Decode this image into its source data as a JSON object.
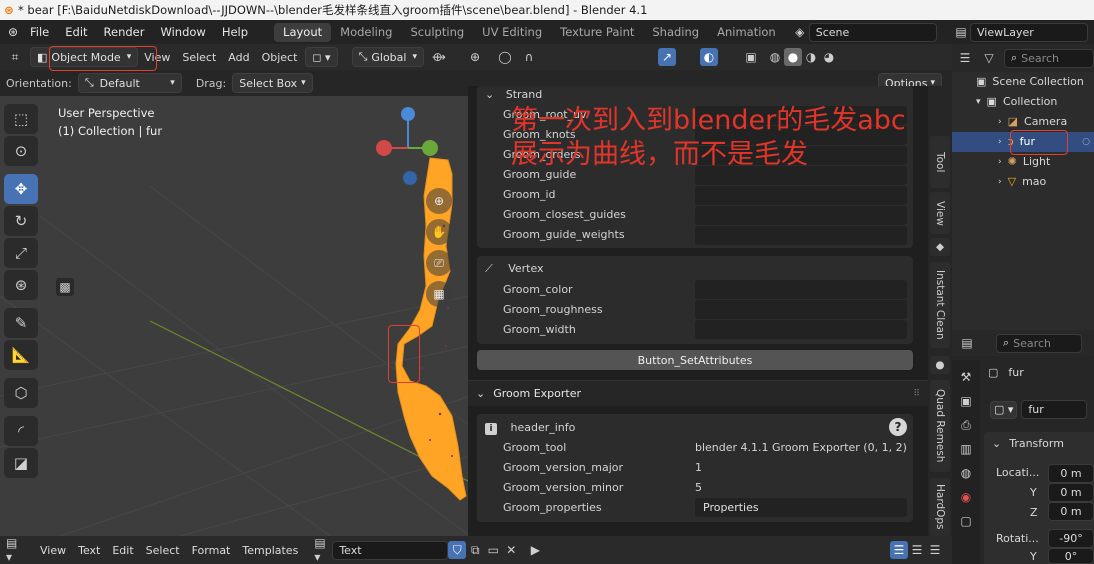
{
  "window": {
    "title": "* bear [F:\\BaiduNetdiskDownload\\--JJDOWN--\\blender毛发样条线直入groom插件\\scene\\bear.blend] - Blender 4.1"
  },
  "menus": [
    "File",
    "Edit",
    "Render",
    "Window",
    "Help"
  ],
  "workspaces": [
    "Layout",
    "Modeling",
    "Sculpting",
    "UV Editing",
    "Texture Paint",
    "Shading",
    "Animation"
  ],
  "active_workspace": "Layout",
  "scene_field": "Scene",
  "viewlayer_field": "ViewLayer",
  "viewport_header": {
    "mode": "Object Mode",
    "menus": [
      "View",
      "Select",
      "Add",
      "Object"
    ],
    "transform_orientation": "Global"
  },
  "tool_header": {
    "orientation_label": "Orientation:",
    "orientation_value": "Default",
    "drag_label": "Drag:",
    "drag_value": "Select Box",
    "options": "Options"
  },
  "viewport": {
    "perspective": "User Perspective",
    "collection_info": "(1) Collection | fur",
    "accent_color": "#ffa424"
  },
  "panel": {
    "strand_header": "Strand",
    "strand_rows": [
      "Groom_root_uv",
      "Groom_knots",
      "Groom_orders",
      "Groom_guide",
      "Groom_id",
      "Groom_closest_guides",
      "Groom_guide_weights"
    ],
    "vertex_header": "Vertex",
    "vertex_rows": [
      "Groom_color",
      "Groom_roughness",
      "Groom_width"
    ],
    "button": "Button_SetAttributes",
    "exporter_header": "Groom Exporter",
    "header_info_label": "header_info",
    "header_info": [
      {
        "key": "Groom_tool",
        "value": "blender 4.1.1 Groom Exporter (0, 1, 2)"
      },
      {
        "key": "Groom_version_major",
        "value": "1"
      },
      {
        "key": "Groom_version_minor",
        "value": "5"
      },
      {
        "key": "Groom_properties",
        "value": "Properties"
      }
    ]
  },
  "side_tabs": [
    "Tool",
    "View",
    "Instant Clean",
    "Quad Remesh",
    "HardOps"
  ],
  "outliner": {
    "search_placeholder": "Search",
    "items": [
      {
        "label": "Scene Collection",
        "icon": "scene-collection-icon"
      },
      {
        "label": "Collection",
        "icon": "collection-icon"
      },
      {
        "label": "Camera",
        "icon": "camera-icon"
      },
      {
        "label": "fur",
        "icon": "curves-icon"
      },
      {
        "label": "Light",
        "icon": "light-icon"
      },
      {
        "label": "mao",
        "icon": "mesh-icon"
      }
    ]
  },
  "properties": {
    "search_placeholder": "Search",
    "object_name": "fur",
    "object_field": "fur",
    "transform_header": "Transform",
    "location_label": "Locati...",
    "loc_axes": [
      "",
      "Y",
      "Z"
    ],
    "loc_values": [
      "0 m",
      "0 m",
      "0 m"
    ],
    "rotation_label": "Rotati...",
    "rot_axes": [
      "",
      "Y"
    ],
    "rot_values": [
      "-90°",
      "0°"
    ]
  },
  "text_editor": {
    "menus": [
      "View",
      "Text",
      "Edit",
      "Select",
      "Format",
      "Templates"
    ],
    "text_block": "Text"
  },
  "annotation": {
    "line1": "第一次到入到blender的毛发abc",
    "line2": "展示为曲线，而不是毛发",
    "color": "#e2352a"
  }
}
